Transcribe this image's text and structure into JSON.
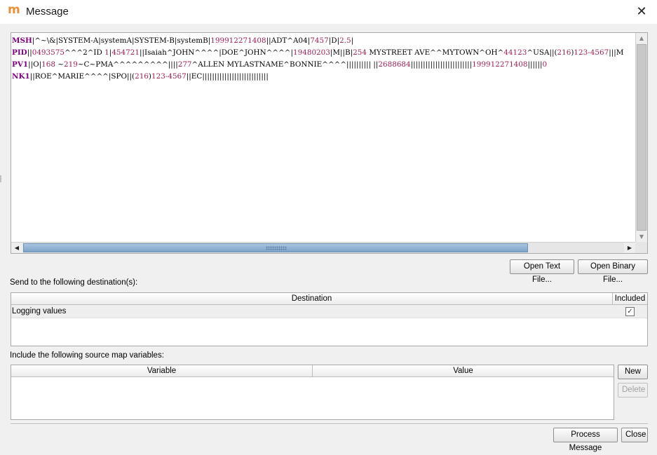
{
  "window": {
    "title": "Message",
    "app_icon": "m",
    "close_glyph": "✕"
  },
  "message": {
    "lines": [
      [
        {
          "t": "MSH",
          "c": "seg"
        },
        {
          "t": "|^~\\&|SYSTEM-A|systemA|SYSTEM-B|systemB|",
          "c": "txt"
        },
        {
          "t": "199912271408",
          "c": "num"
        },
        {
          "t": "||ADT^A04|",
          "c": "txt"
        },
        {
          "t": "7457",
          "c": "num"
        },
        {
          "t": "|D|",
          "c": "txt"
        },
        {
          "t": "2.5",
          "c": "num"
        },
        {
          "t": "|",
          "c": "txt"
        }
      ],
      [
        {
          "t": "PID",
          "c": "seg"
        },
        {
          "t": "||",
          "c": "txt"
        },
        {
          "t": "0493575",
          "c": "num"
        },
        {
          "t": "^^^2^ID ",
          "c": "txt"
        },
        {
          "t": "1",
          "c": "num"
        },
        {
          "t": "|",
          "c": "txt"
        },
        {
          "t": "454721",
          "c": "num"
        },
        {
          "t": "||Isaiah^JOHN^^^^|DOE^JOHN^^^^|",
          "c": "txt"
        },
        {
          "t": "19480203",
          "c": "num"
        },
        {
          "t": "|M||B|",
          "c": "txt"
        },
        {
          "t": "254",
          "c": "num"
        },
        {
          "t": " MYSTREET AVE^^MYTOWN^OH^",
          "c": "txt"
        },
        {
          "t": "44123",
          "c": "num"
        },
        {
          "t": "^USA||(",
          "c": "txt"
        },
        {
          "t": "216",
          "c": "num"
        },
        {
          "t": ")",
          "c": "txt"
        },
        {
          "t": "123-4567",
          "c": "num"
        },
        {
          "t": "|||M",
          "c": "txt"
        }
      ],
      [
        {
          "t": "PV1",
          "c": "seg"
        },
        {
          "t": "||O|",
          "c": "txt"
        },
        {
          "t": "168",
          "c": "num"
        },
        {
          "t": " ~",
          "c": "txt"
        },
        {
          "t": "219",
          "c": "num"
        },
        {
          "t": "~C~PMA^^^^^^^^^||||",
          "c": "txt"
        },
        {
          "t": "277",
          "c": "num"
        },
        {
          "t": "^ALLEN MYLASTNAME^BONNIE^^^^|||||||||| ||",
          "c": "txt"
        },
        {
          "t": "2688684",
          "c": "num"
        },
        {
          "t": "|||||||||||||||||||||||||",
          "c": "txt"
        },
        {
          "t": "199912271408",
          "c": "num"
        },
        {
          "t": "||||||",
          "c": "txt"
        },
        {
          "t": "0",
          "c": "num"
        }
      ],
      [
        {
          "t": "NK1",
          "c": "seg"
        },
        {
          "t": "||ROE^MARIE^^^^|SPO||(",
          "c": "txt"
        },
        {
          "t": "216",
          "c": "num"
        },
        {
          "t": ")",
          "c": "txt"
        },
        {
          "t": "123-4567",
          "c": "num"
        },
        {
          "t": "||EC|||||||||||||||||||||||||||",
          "c": "txt"
        }
      ]
    ]
  },
  "scroll": {
    "up": "▲",
    "down": "▼",
    "left": "◀",
    "right": "▶"
  },
  "file_buttons": {
    "open_text": "Open Text File...",
    "open_binary": "Open Binary File..."
  },
  "destinations": {
    "label": "Send to the following destination(s):",
    "col_destination": "Destination",
    "col_included": "Included",
    "rows": [
      {
        "name": "Logging values",
        "included": true,
        "check": "✓"
      }
    ]
  },
  "variables": {
    "label": "Include the following source map variables:",
    "col_variable": "Variable",
    "col_value": "Value",
    "new_label": "New",
    "delete_label": "Delete"
  },
  "footer": {
    "process_label": "Process Message",
    "close_label": "Close"
  }
}
